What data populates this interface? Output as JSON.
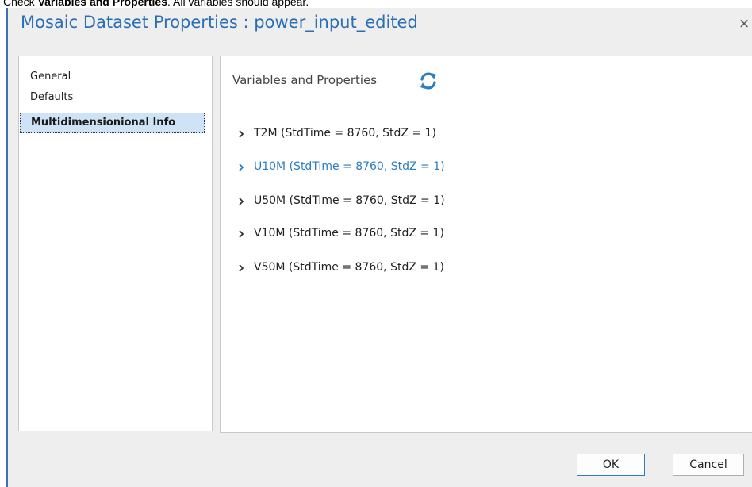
{
  "caption": {
    "prefix": "Check ",
    "bold": "Variables and Properties",
    "suffix": ". All variables should appear."
  },
  "dialog": {
    "title": "Mosaic Dataset Properties : power_input_edited",
    "close_glyph": "×",
    "nav_items": [
      {
        "label": "General",
        "selected": false
      },
      {
        "label": "Defaults",
        "selected": false
      },
      {
        "label": "Multidimensionional Info",
        "selected": true
      }
    ],
    "content": {
      "section_title": "Variables and Properties",
      "refresh_icon": "refresh-icon",
      "variables": [
        {
          "label": "T2M (StdTime = 8760, StdZ = 1)",
          "hover": false
        },
        {
          "label": "U10M (StdTime = 8760, StdZ = 1)",
          "hover": true
        },
        {
          "label": "U50M (StdTime = 8760, StdZ = 1)",
          "hover": false
        },
        {
          "label": "V10M (StdTime = 8760, StdZ = 1)",
          "hover": false
        },
        {
          "label": "V50M (StdTime = 8760, StdZ = 1)",
          "hover": false
        }
      ]
    },
    "buttons": {
      "ok_label": "OK",
      "cancel_label": "Cancel"
    }
  },
  "colors": {
    "title_blue": "#2a6fb4",
    "accent_blue": "#2a7ec3",
    "selected_bg": "#cfe3f7",
    "dialog_bg": "#eeeeee"
  }
}
